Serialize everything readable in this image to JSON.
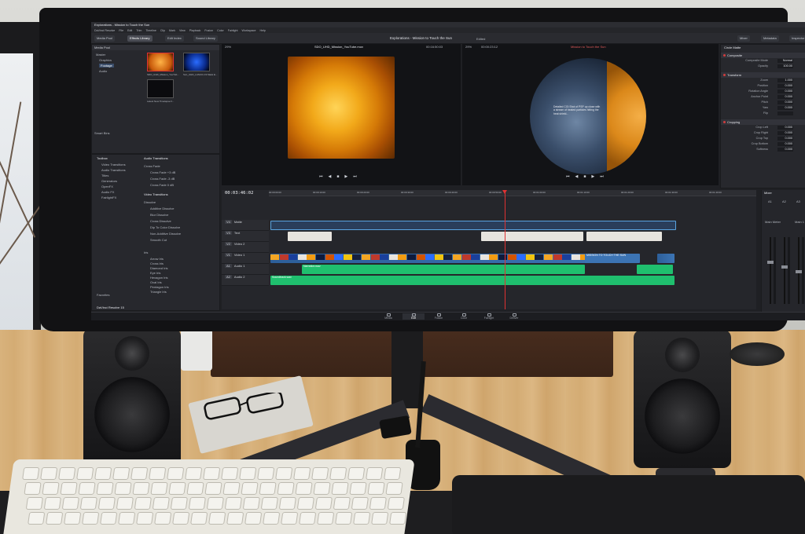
{
  "app": {
    "window_title": "Explorations - Mission to Touch the Sun",
    "version_label": "DaVinci Resolve 15",
    "menu": [
      "DaVinci Resolve",
      "File",
      "Edit",
      "Trim",
      "Timeline",
      "Clip",
      "Mark",
      "View",
      "Playback",
      "Fusion",
      "Color",
      "Fairlight",
      "Workspace",
      "Help"
    ]
  },
  "toolbar": {
    "left_buttons": [
      "Media Pool",
      "Effects Library",
      "Edit Index",
      "Sound Library"
    ],
    "project_title": "Explorations - Mission to Touch the Sun",
    "project_status": "Edited",
    "right_buttons": [
      "Mixer",
      "Metadata",
      "Inspector"
    ],
    "timecode_left": "00:00:00:11",
    "timecode_right": "00:03:46:02"
  },
  "media_pool": {
    "bins": [
      "Master",
      "Graphics",
      "Footage",
      "Audio"
    ],
    "selected_bin": "Footage",
    "clips": [
      "SDO_UHD_Mission_YouTub...",
      "Sun_UHD_LASCO-C3 Mask E...",
      "Latest New Timelapse F..."
    ],
    "smart_bins_label": "Smart Bins"
  },
  "effects": {
    "tree": [
      "Toolbox",
      "Video Transitions",
      "Audio Transitions",
      "Titles",
      "Generators",
      "OpenFX",
      "Audio FX",
      "FairlightFX"
    ],
    "audio_transitions_header": "Audio Transitions",
    "cross_fade_header": "Cross Fade",
    "audio_transitions": [
      "Cross Fade +3 dB",
      "Cross Fade -3 dB",
      "Cross Fade 0 dB"
    ],
    "video_transitions_header": "Video Transitions",
    "dissolve_header": "Dissolve",
    "dissolves": [
      "Additive Dissolve",
      "Blur Dissolve",
      "Cross Dissolve",
      "Dip To Color Dissolve",
      "Non-Additive Dissolve",
      "Smooth Cut"
    ],
    "iris_header": "Iris",
    "iris": [
      "Arrow Iris",
      "Cross Iris",
      "Diamond Iris",
      "Eye Iris",
      "Hexagon Iris",
      "Oval Iris",
      "Pentagon Iris",
      "Triangle Iris"
    ],
    "favorites_label": "Favorites"
  },
  "source_viewer": {
    "clip_name": "SDO_UHD_Mission_YouTube.mov",
    "timecode": "00:16:50:03",
    "zoom": "29%"
  },
  "timeline_viewer": {
    "zoom": "29%",
    "timecode": "00:00:23:12",
    "overlay_title": "Mission to Touch the Sun",
    "caption": "Detailed CGI Shot of PSP up close with a stream of heated particles hitting the heat shield..."
  },
  "inspector": {
    "header": "Circle Matte",
    "sections": [
      {
        "title": "Composite",
        "rows": [
          {
            "label": "Composite Mode",
            "value": "Normal"
          },
          {
            "label": "Opacity",
            "value": "100.00"
          }
        ]
      },
      {
        "title": "Transform",
        "rows": [
          {
            "label": "Zoom",
            "value": "1.000"
          },
          {
            "label": "Position",
            "value": "0.000"
          },
          {
            "label": "Rotation Angle",
            "value": "0.000"
          },
          {
            "label": "Anchor Point",
            "value": "0.000"
          },
          {
            "label": "Pitch",
            "value": "0.000"
          },
          {
            "label": "Yaw",
            "value": "0.000"
          },
          {
            "label": "Flip",
            "value": ""
          }
        ]
      },
      {
        "title": "Cropping",
        "rows": [
          {
            "label": "Crop Left",
            "value": "0.000"
          },
          {
            "label": "Crop Right",
            "value": "0.000"
          },
          {
            "label": "Crop Top",
            "value": "0.000"
          },
          {
            "label": "Crop Bottom",
            "value": "0.000"
          },
          {
            "label": "Softness",
            "value": "0.000"
          }
        ]
      }
    ]
  },
  "timeline": {
    "timecode": "00:03:46:02",
    "ruler_marks": [
      "00:00:00:00",
      "00:00:10:00",
      "00:00:20:00",
      "00:00:30:00",
      "00:00:40:00",
      "00:00:50:00",
      "00:01:00:00",
      "00:01:10:00",
      "00:01:20:00",
      "00:01:30:00",
      "00:01:40:00"
    ],
    "tracks": [
      {
        "id": "V4",
        "name": "Matte"
      },
      {
        "id": "V3",
        "name": "Text"
      },
      {
        "id": "V2",
        "name": "Video 2"
      },
      {
        "id": "V1",
        "name": "Video 1"
      },
      {
        "id": "A1",
        "name": "Audio 1"
      },
      {
        "id": "A2",
        "name": "Audio 2"
      }
    ],
    "video_clip_label": "Sun_UHD_LASCO-C3...",
    "audio_clip_label": "Narration.wav",
    "music_clip_label": "Soundtrack.wav",
    "title_overlay": "MISSION TO TOUCH THE SUN"
  },
  "mixer": {
    "title": "Mixer",
    "channels": [
      "A1",
      "A2",
      "A3"
    ],
    "bus_label": "Main 1",
    "master_label": "Main Meter"
  },
  "pages": [
    "Media",
    "Edit",
    "Fusion",
    "Color",
    "Fairlight",
    "Deliver"
  ],
  "active_page": "Edit",
  "colors": {
    "accent": "#e03232",
    "video_clip": "#2d5f9a",
    "audio_clip": "#1fbf6e",
    "ui_bg": "#1f2024",
    "desk": "#d4ac74"
  }
}
